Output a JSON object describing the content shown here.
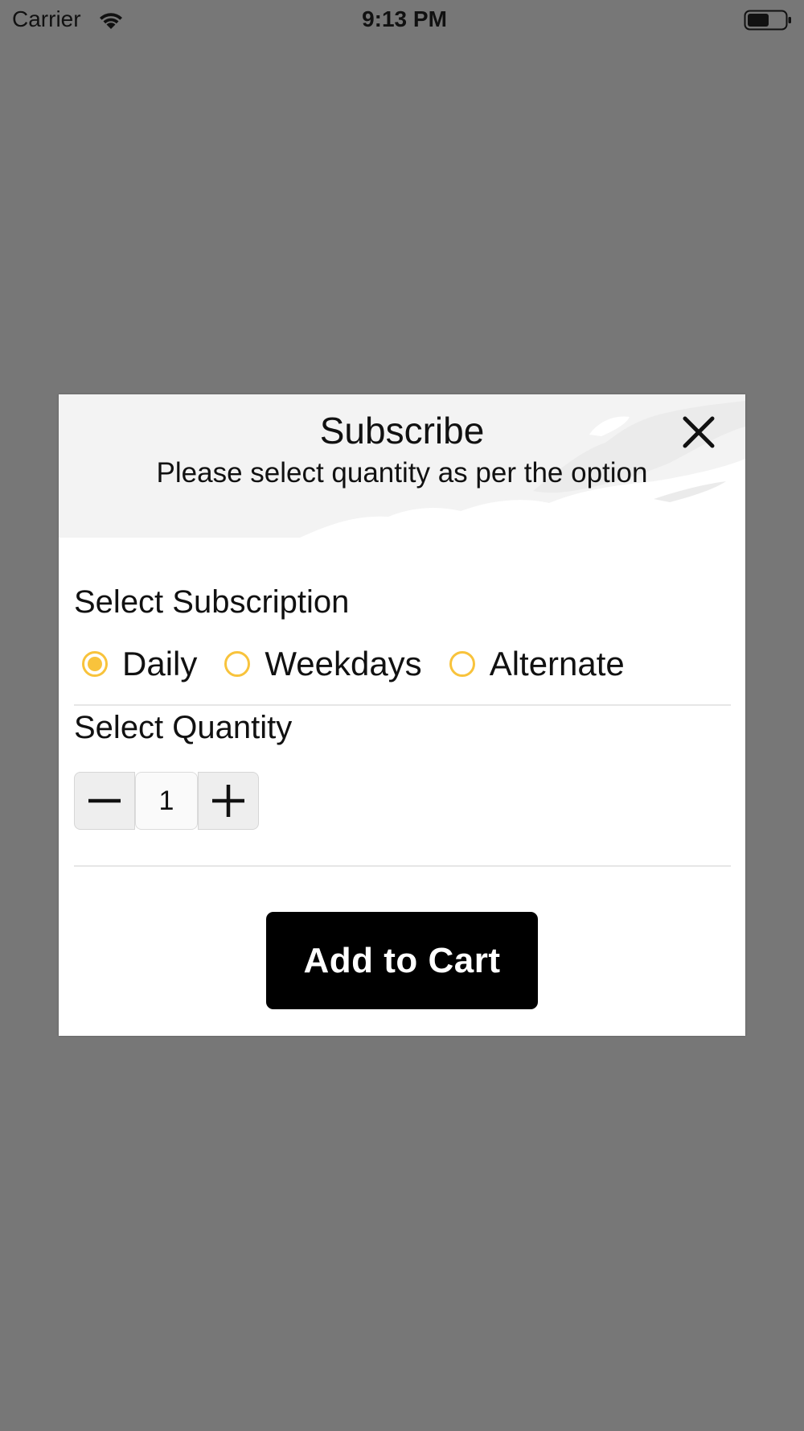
{
  "status_bar": {
    "carrier": "Carrier",
    "time": "9:13 PM",
    "wifi_icon": "wifi-icon",
    "battery_icon": "battery-icon"
  },
  "modal": {
    "title": "Subscribe",
    "subtitle": "Please select quantity as per the option",
    "close_icon": "close-icon",
    "subscription": {
      "label": "Select Subscription",
      "options": [
        {
          "label": "Daily",
          "selected": true
        },
        {
          "label": "Weekdays",
          "selected": false
        },
        {
          "label": "Alternate",
          "selected": false
        }
      ]
    },
    "quantity": {
      "label": "Select Quantity",
      "value": "1",
      "minus_icon": "minus-icon",
      "plus_icon": "plus-icon"
    },
    "add_to_cart_label": "Add to Cart"
  },
  "colors": {
    "overlay": "#777777",
    "accent": "#f8c33c",
    "button_bg": "#000000",
    "header_bg": "#f3f3f3"
  }
}
